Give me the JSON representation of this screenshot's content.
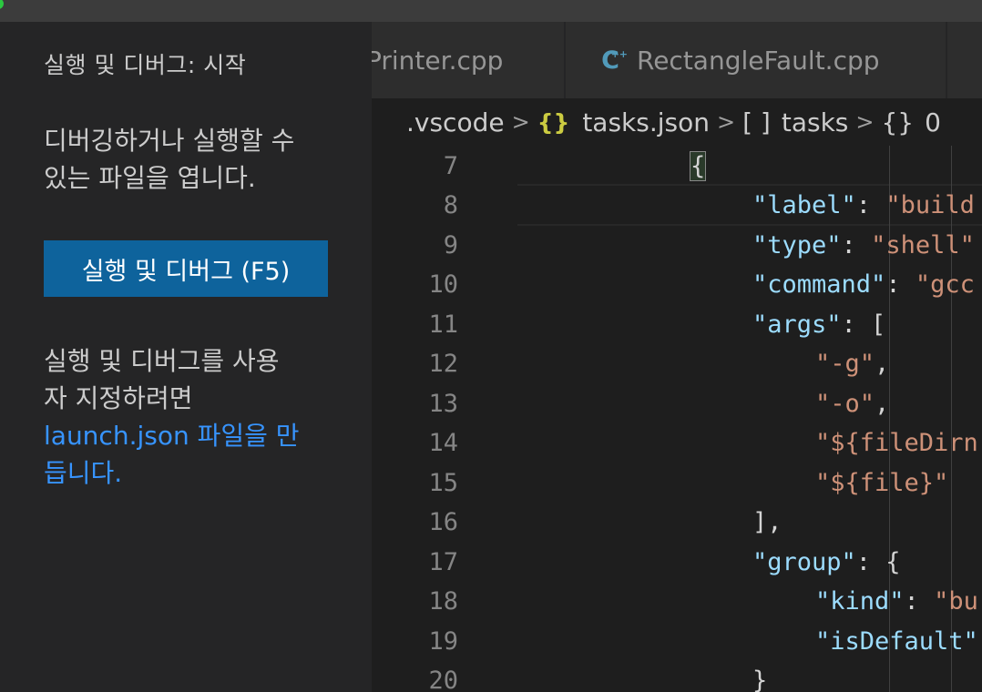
{
  "sidebar": {
    "title": "실행 및 디버그: 시작",
    "description_line1": "디버깅하거나 실행할 수",
    "description_line2": "있는 파일을 엽니다.",
    "run_button": "실행 및 디버그 (F5)",
    "customize_line1": "실행 및 디버그를 사용",
    "customize_line2": "자 지정하려면",
    "customize_link_line1": "launch.json 파일을 만",
    "customize_link_line2": "듭니다."
  },
  "tabs": [
    {
      "label": "Printer.cpp"
    },
    {
      "label": "RectangleFault.cpp",
      "icon": "cpp-file-icon"
    },
    {
      "label": "",
      "icon": "cpp-file-icon"
    }
  ],
  "breadcrumb": {
    "folder": ".vscode",
    "file": "tasks.json",
    "array_glyph": "[ ]",
    "array": "tasks",
    "object_glyph": "{}",
    "object": "0"
  },
  "editor": {
    "lines": [
      {
        "num": "7",
        "tokens": [
          {
            "t": "{",
            "c": "p"
          }
        ]
      },
      {
        "num": "8",
        "tokens": [
          {
            "t": "\"label\"",
            "c": "k"
          },
          {
            "t": ": ",
            "c": "p"
          },
          {
            "t": "\"build",
            "c": "s"
          }
        ]
      },
      {
        "num": "9",
        "tokens": [
          {
            "t": "\"type\"",
            "c": "k"
          },
          {
            "t": ": ",
            "c": "p"
          },
          {
            "t": "\"shell\"",
            "c": "s"
          }
        ]
      },
      {
        "num": "10",
        "tokens": [
          {
            "t": "\"command\"",
            "c": "k"
          },
          {
            "t": ": ",
            "c": "p"
          },
          {
            "t": "\"gcc",
            "c": "s"
          }
        ]
      },
      {
        "num": "11",
        "tokens": [
          {
            "t": "\"args\"",
            "c": "k"
          },
          {
            "t": ": [",
            "c": "p"
          }
        ]
      },
      {
        "num": "12",
        "tokens": [
          {
            "t": "\"-g\"",
            "c": "s"
          },
          {
            "t": ",",
            "c": "p"
          }
        ]
      },
      {
        "num": "13",
        "tokens": [
          {
            "t": "\"-o\"",
            "c": "s"
          },
          {
            "t": ",",
            "c": "p"
          }
        ]
      },
      {
        "num": "14",
        "tokens": [
          {
            "t": "\"${fileDirn",
            "c": "s"
          }
        ]
      },
      {
        "num": "15",
        "tokens": [
          {
            "t": "\"${file}\"",
            "c": "s"
          }
        ]
      },
      {
        "num": "16",
        "tokens": [
          {
            "t": "],",
            "c": "p"
          }
        ]
      },
      {
        "num": "17",
        "tokens": [
          {
            "t": "\"group\"",
            "c": "k"
          },
          {
            "t": ": {",
            "c": "p"
          }
        ]
      },
      {
        "num": "18",
        "tokens": [
          {
            "t": "\"kind\"",
            "c": "k"
          },
          {
            "t": ": ",
            "c": "p"
          },
          {
            "t": "\"bu",
            "c": "s"
          }
        ]
      },
      {
        "num": "19",
        "tokens": [
          {
            "t": "\"isDefault\"",
            "c": "k"
          }
        ]
      },
      {
        "num": "20",
        "tokens": [
          {
            "t": "}",
            "c": "p"
          }
        ]
      }
    ]
  },
  "colors": {
    "key": "#9cdcfe",
    "string": "#ce9178",
    "punct": "#d4d4d4",
    "accent_button": "#0e639c",
    "link": "#3794ff"
  }
}
